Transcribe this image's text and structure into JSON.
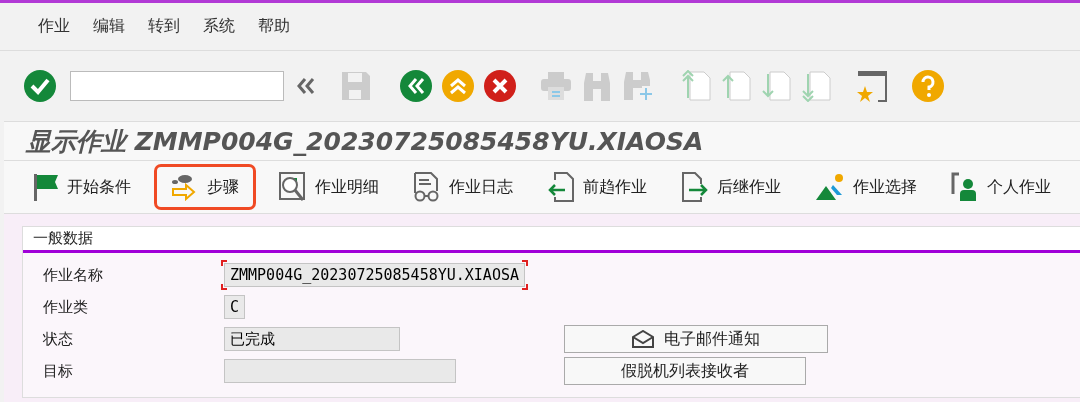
{
  "menu": [
    "作业",
    "编辑",
    "转到",
    "系统",
    "帮助"
  ],
  "toolbar": {
    "buttons": [
      {
        "kind": "back",
        "disabled": false
      },
      {
        "kind": "exit",
        "disabled": false
      },
      {
        "kind": "cancel",
        "disabled": false
      }
    ]
  },
  "title": "显示作业 ZMMP004G_20230725085458YU.XIAOSA",
  "app_toolbar": [
    {
      "kind": "flag",
      "label": "开始条件",
      "highlighted": false
    },
    {
      "kind": "steps",
      "label": "步骤",
      "highlighted": true
    },
    {
      "kind": "details",
      "label": "作业明细",
      "highlighted": false
    },
    {
      "kind": "log",
      "label": "作业日志",
      "highlighted": false
    },
    {
      "kind": "pred",
      "label": "前趋作业",
      "highlighted": false
    },
    {
      "kind": "succ",
      "label": "后继作业",
      "highlighted": false
    },
    {
      "kind": "select",
      "label": "作业选择",
      "highlighted": false
    },
    {
      "kind": "own",
      "label": "个人作业",
      "highlighted": false
    }
  ],
  "general_data": {
    "title": "一般数据",
    "fields": [
      {
        "label": "作业名称",
        "value": "ZMMP004G_20230725085458YU.XIAOSA",
        "focused": true
      },
      {
        "label": "作业类",
        "value": "C",
        "focused": false
      },
      {
        "label": "状态",
        "value": "已完成",
        "focused": false
      },
      {
        "label": "目标",
        "focused": false
      }
    ],
    "buttons": [
      {
        "kind": "mail",
        "label": "电子邮件通知"
      },
      {
        "kind": "plain",
        "label": "假脱机列表接收者"
      }
    ]
  }
}
